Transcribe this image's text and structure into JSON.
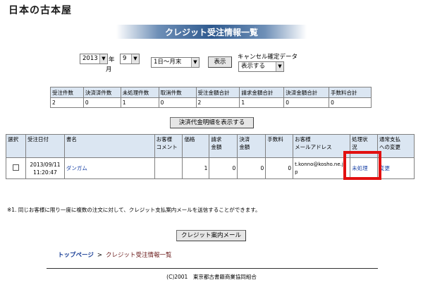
{
  "logo": "日本の古本屋",
  "page_title": "クレジット受注情報一覧",
  "filters": {
    "year_value": "2013",
    "year_unit": "年",
    "month_value": "9",
    "month_unit": "月",
    "range_value": "1日～月末",
    "display_button": "表示",
    "cancel_label": "キャンセル確定データ",
    "cancel_value": "表示する"
  },
  "summary": {
    "headers": [
      "受注件数",
      "決済済件数",
      "未処理件数",
      "取消件数",
      "受注金額合計",
      "請求金額合計",
      "決済金額合計",
      "手数料合計"
    ],
    "values": [
      "2",
      "0",
      "1",
      "0",
      "2",
      "1",
      "0",
      "0"
    ]
  },
  "details_button": "決済代金明細を表示する",
  "orders": {
    "headers": [
      "選択",
      "受注日付",
      "書名",
      "お客様\nコメント",
      "価格",
      "請求\n金額",
      "決済\n金額",
      "手数料",
      "お客様\nメールアドレス",
      "処理状\n況",
      "通常支払\nへの変更"
    ],
    "rows": [
      {
        "date": "2013/09/11\n11:20:47",
        "title": "ダンガム",
        "comment": "",
        "price": "1",
        "billed": "0",
        "settled": "0",
        "fee": "0",
        "email": "t.konno@kosho.ne.j\np",
        "status": "未処理",
        "change": "変更"
      }
    ]
  },
  "note": "※1. 同じお客様に限り一度に複数の注文に対して、クレジット支払案内メールを送信することができます。",
  "mail_button": "クレジット案内メール",
  "breadcrumb": {
    "home": "トップページ",
    "separator": ">",
    "current": "クレジット受注情報一覧"
  },
  "footer": "(C)2001　東京都古書籍商業協同組合",
  "colors": {
    "banner": "#2f5a8f",
    "header_bg": "#dbe6f2",
    "link": "#1f47a8",
    "highlight": "#e21010"
  }
}
